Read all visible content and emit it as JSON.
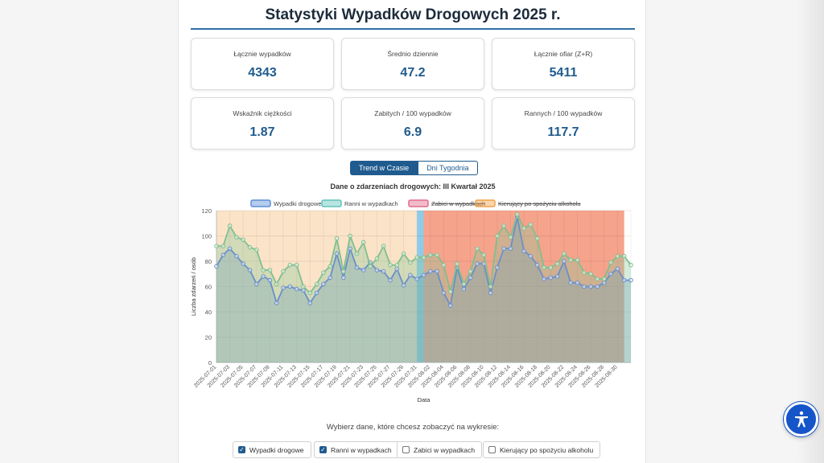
{
  "page": {
    "title": "Statystyki Wypadków Drogowych 2025 r.",
    "colors": {
      "accent": "#1f5b8e",
      "title_rule": "#2f6fa7",
      "a11y": "#1554c9"
    }
  },
  "stats": [
    {
      "label": "Łącznie wypadków",
      "value": "4343"
    },
    {
      "label": "Średnio dziennie",
      "value": "47.2"
    },
    {
      "label": "Łącznie ofiar (Z+R)",
      "value": "5411"
    },
    {
      "label": "Wskaźnik ciężkości",
      "value": "1.87"
    },
    {
      "label": "Zabitych / 100 wypadków",
      "value": "6.9"
    },
    {
      "label": "Rannych / 100 wypadków",
      "value": "117.7"
    }
  ],
  "tabs": [
    {
      "label": "Trend w Czasie",
      "active": true
    },
    {
      "label": "Dni Tygodnia",
      "active": false
    }
  ],
  "chart_title": "Dane o zdarzeniach drogowych: III Kwartał 2025",
  "controls": {
    "prompt": "Wybierz dane, które chcesz zobaczyć na wykresie:",
    "options": [
      {
        "label": "Wypadki drogowe",
        "checked": true
      },
      {
        "label": "Ranni w wypadkach",
        "checked": true
      },
      {
        "label": "Zabici w wypadkach",
        "checked": false
      },
      {
        "label": "Kierujący po spożyciu alkoholu",
        "checked": false
      }
    ]
  },
  "accessibility_icon": "accessibility-person-icon",
  "chart_data": {
    "type": "area",
    "title": "Dane o zdarzeniach drogowych: III Kwartał 2025",
    "xlabel": "Data",
    "ylabel": "Liczba zdarzeń / osób",
    "ylim": [
      0,
      120
    ],
    "yticks": [
      0,
      20,
      40,
      60,
      80,
      100,
      120
    ],
    "grid": true,
    "legend_position": "top",
    "start_date": "2025-07-01",
    "x_tick_labels": [
      "2025-07-01",
      "2025-07-03",
      "2025-07-05",
      "2025-07-07",
      "2025-07-09",
      "2025-07-11",
      "2025-07-13",
      "2025-07-15",
      "2025-07-17",
      "2025-07-19",
      "2025-07-21",
      "2025-07-23",
      "2025-07-25",
      "2025-07-27",
      "2025-07-29",
      "2025-07-31",
      "2025-08-02",
      "2025-08-04",
      "2025-08-06",
      "2025-08-08",
      "2025-08-10",
      "2025-08-12",
      "2025-08-14",
      "2025-08-16",
      "2025-08-18",
      "2025-08-20",
      "2025-08-22",
      "2025-08-24",
      "2025-08-26",
      "2025-08-28",
      "2025-08-30"
    ],
    "legend": [
      {
        "name": "Wypadki drogowe",
        "color": "#5b8fd6",
        "hidden": false
      },
      {
        "name": "Ranni w wypadkach",
        "color": "#5fc4b8",
        "hidden": false
      },
      {
        "name": "Zabici w wypadkach",
        "color": "#e06b8a",
        "hidden": true
      },
      {
        "name": "Kierujący po spożyciu alkoholu",
        "color": "#f0a24a",
        "hidden": true
      }
    ],
    "background_bands": [
      {
        "from": "2025-07-01",
        "to": "2025-07-31",
        "color": "#fbe3c8"
      },
      {
        "from": "2025-07-31",
        "to": "2025-08-01",
        "color": "#8ecbe8"
      },
      {
        "from": "2025-08-01",
        "to": "2025-08-31",
        "color": "#f6a38c"
      }
    ],
    "series": [
      {
        "name": "Wypadki drogowe",
        "color": "#6a8fc8",
        "values": [
          76,
          85,
          90,
          84,
          78,
          73,
          62,
          68,
          65,
          47,
          59,
          60,
          58,
          57,
          47,
          55,
          62,
          67,
          86,
          67,
          90,
          75,
          73,
          79,
          73,
          72,
          65,
          74,
          61,
          69,
          66,
          69,
          72,
          72,
          55,
          45,
          75,
          58,
          67,
          78,
          78,
          55,
          75,
          90,
          90,
          115,
          88,
          84,
          77,
          66,
          67,
          68,
          80,
          63,
          63,
          60,
          60,
          60,
          63,
          70,
          74,
          65,
          65
        ]
      },
      {
        "name": "Ranni w wypadkach",
        "color": "#7fbf8e",
        "values": [
          92,
          92,
          108,
          99,
          97,
          91,
          89,
          73,
          73,
          62,
          72,
          77,
          77,
          60,
          55,
          62,
          71,
          76,
          98,
          72,
          100,
          86,
          95,
          76,
          82,
          92,
          77,
          77,
          86,
          79,
          83,
          83,
          85,
          85,
          77,
          56,
          78,
          62,
          72,
          90,
          85,
          60,
          100,
          108,
          99,
          117,
          106,
          109,
          98,
          75,
          75,
          78,
          86,
          81,
          81,
          71,
          70,
          66,
          66,
          79,
          84,
          84,
          77
        ]
      }
    ]
  }
}
